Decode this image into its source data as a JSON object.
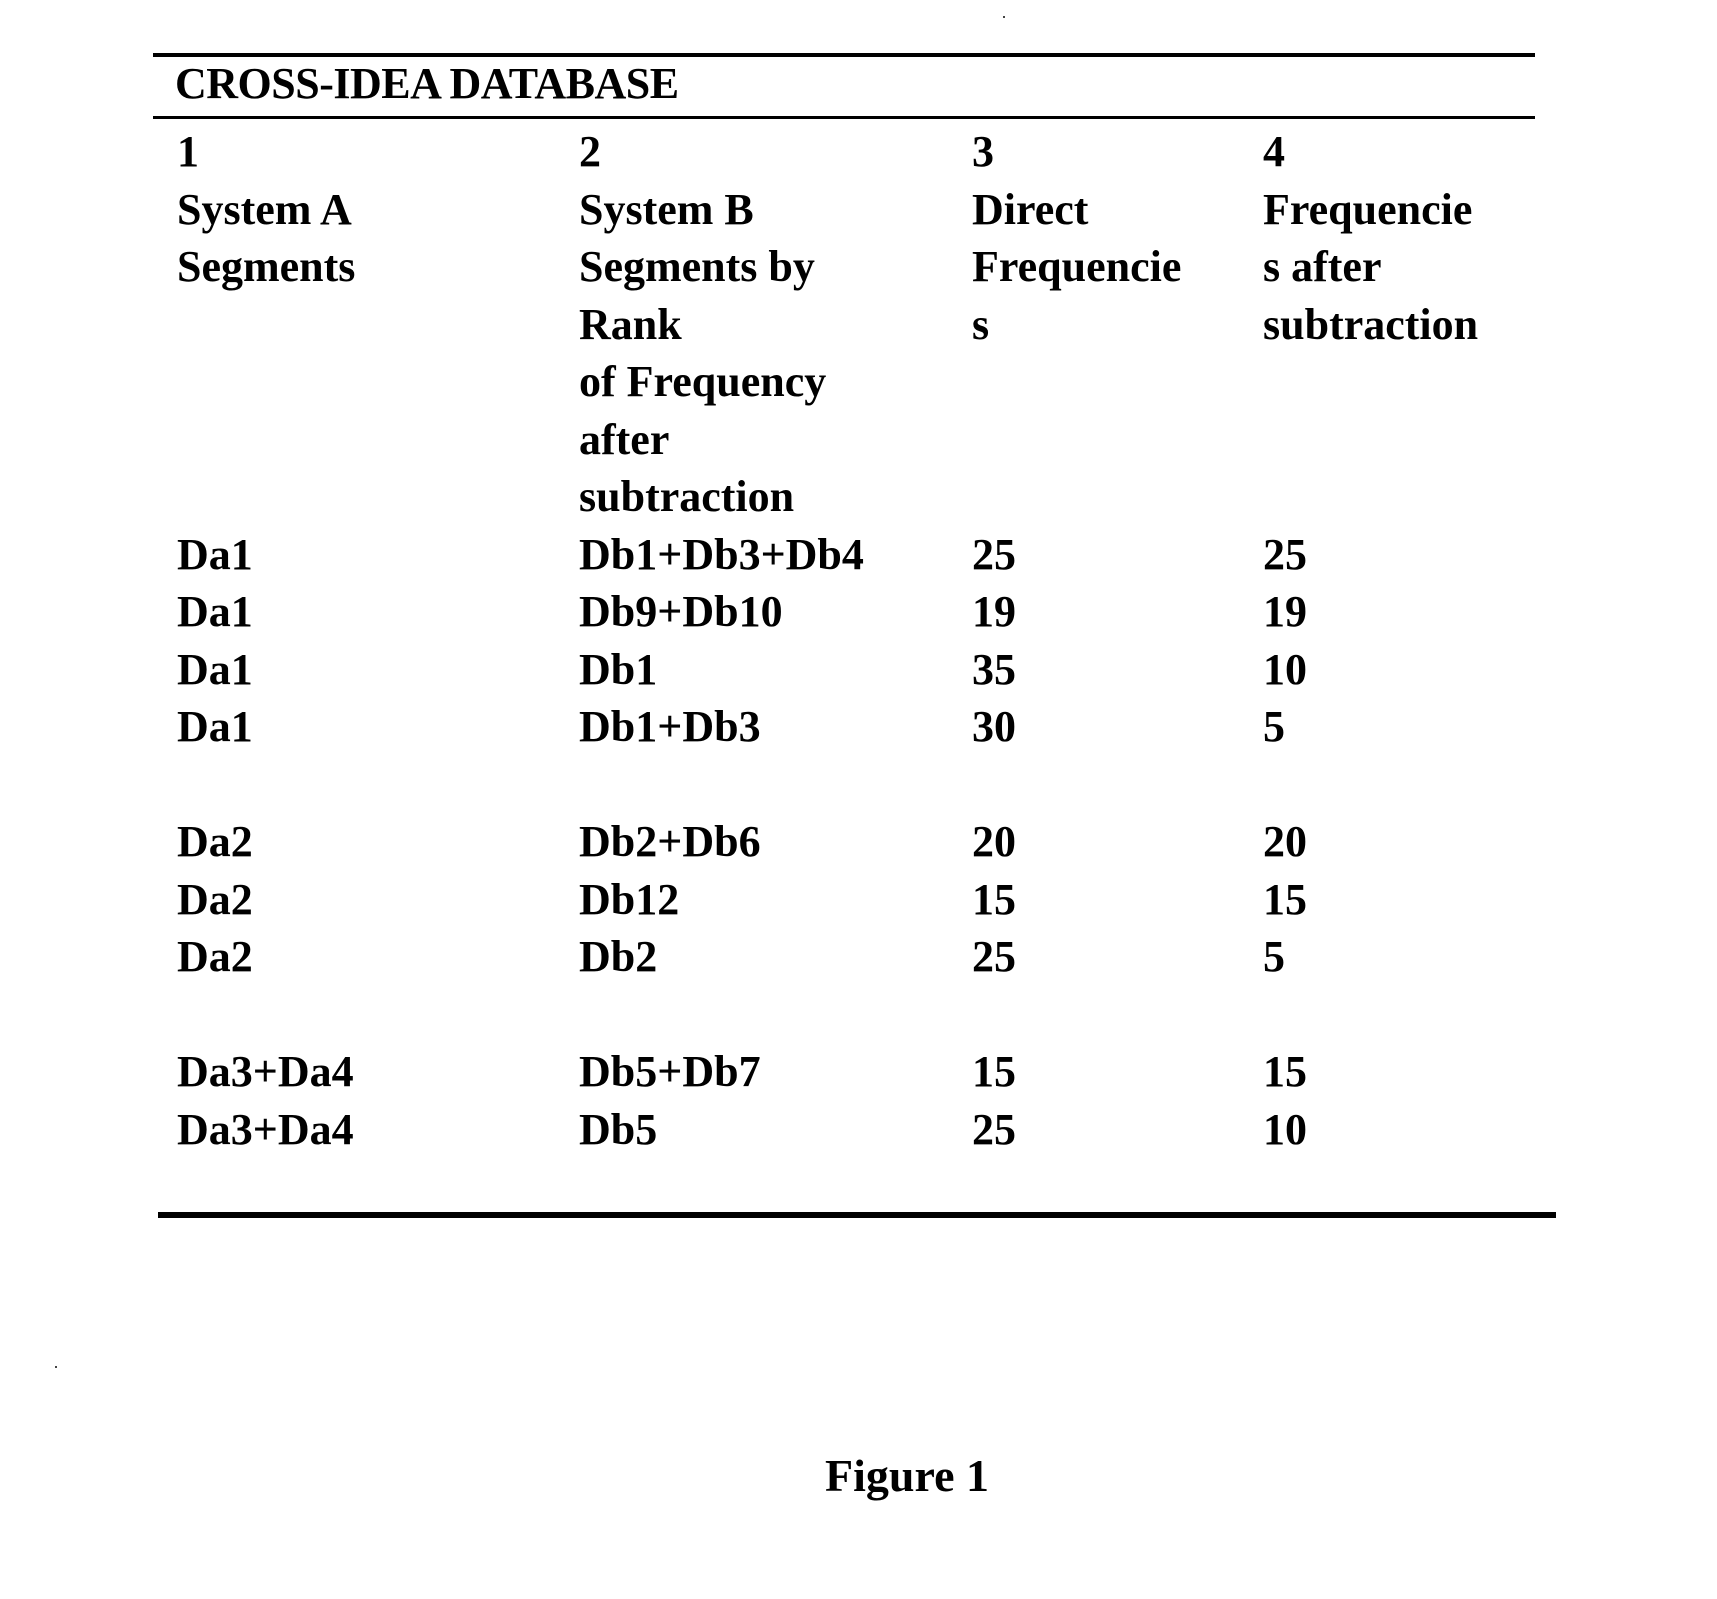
{
  "document": {
    "table_title": "CROSS-IDEA DATABASE",
    "figure_caption": "Figure 1"
  },
  "columns": [
    {
      "number": "1",
      "header_lines": [
        "System A",
        "Segments"
      ]
    },
    {
      "number": "2",
      "header_lines": [
        "System B",
        "Segments by",
        "Rank",
        "of Frequency",
        "after",
        "subtraction"
      ]
    },
    {
      "number": "3",
      "header_lines": [
        "Direct",
        "Frequencie",
        "s"
      ]
    },
    {
      "number": "4",
      "header_lines": [
        "Frequencie",
        "s after",
        "subtraction"
      ]
    }
  ],
  "groups": [
    {
      "rows": [
        [
          "Da1",
          "Db1+Db3+Db4",
          "25",
          "25"
        ],
        [
          "Da1",
          "Db9+Db10",
          "19",
          "19"
        ],
        [
          "Da1",
          "Db1",
          "35",
          "10"
        ],
        [
          "Da1",
          "Db1+Db3",
          "30",
          "5"
        ]
      ]
    },
    {
      "rows": [
        [
          "Da2",
          "Db2+Db6",
          "20",
          "20"
        ],
        [
          "Da2",
          "Db12",
          "15",
          "15"
        ],
        [
          "Da2",
          "Db2",
          "25",
          "5"
        ]
      ]
    },
    {
      "rows": [
        [
          "Da3+Da4",
          "Db5+Db7",
          "15",
          "15"
        ],
        [
          "Da3+Da4",
          "Db5",
          "25",
          "10"
        ]
      ]
    }
  ]
}
